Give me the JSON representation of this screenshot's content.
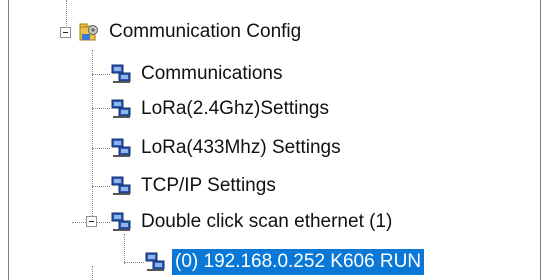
{
  "tree": {
    "root": {
      "label": "Communication Config",
      "icon": "config-folder-icon",
      "expanded": true
    },
    "items": [
      {
        "label": "Communications",
        "icon": "network-icon"
      },
      {
        "label": "LoRa(2.4Ghz)Settings",
        "icon": "network-icon"
      },
      {
        "label": "LoRa(433Mhz) Settings",
        "icon": "network-icon"
      },
      {
        "label": "TCP/IP Settings",
        "icon": "network-icon"
      },
      {
        "label": "Double click scan ethernet (1)",
        "icon": "network-icon",
        "expanded": true,
        "children": [
          {
            "label": "(0) 192.168.0.252 K606 RUN",
            "icon": "network-icon",
            "selected": true
          }
        ]
      }
    ]
  },
  "colors": {
    "selection": "#0a78d7",
    "tree_lines": "#8a8a8a",
    "text": "#111111"
  }
}
